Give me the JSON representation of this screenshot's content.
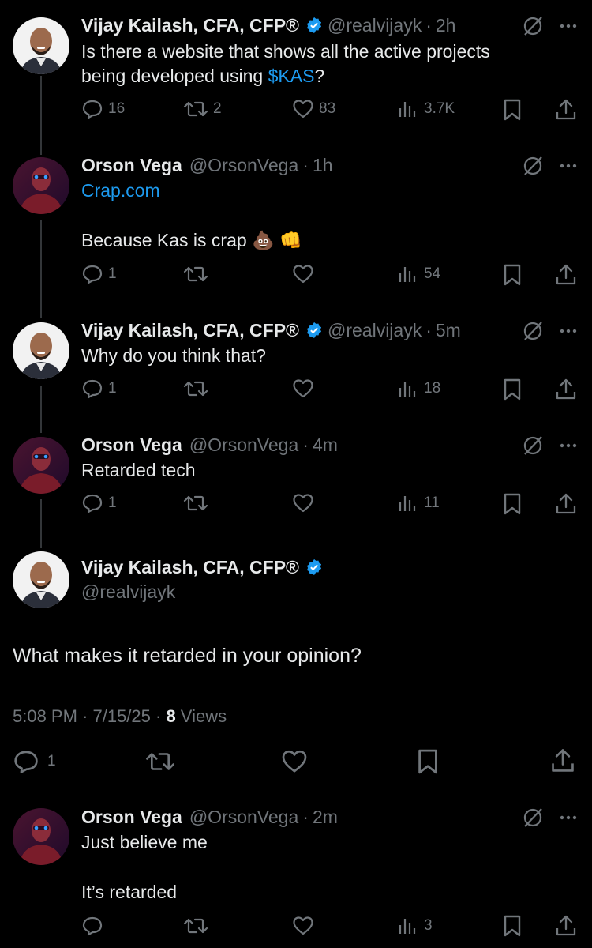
{
  "thread": [
    {
      "author": "Vijay Kailash, CFA, CFP®",
      "handle": "@realvijayk",
      "dot": "·",
      "time": "2h",
      "text_line1": "Is there a website that shows all the active projects",
      "text_line2_pre": "being developed using ",
      "text_line2_link": "$KAS",
      "text_line2_post": "?",
      "replies": "16",
      "reposts": "2",
      "likes": "83",
      "views": "3.7K"
    },
    {
      "author": "Orson Vega",
      "handle": "@OrsonVega",
      "dot": "·",
      "time": "1h",
      "link": "Crap.com",
      "text": "Because Kas is crap 💩 👊",
      "replies": "1",
      "views": "54"
    },
    {
      "author": "Vijay Kailash, CFA, CFP®",
      "handle": "@realvijayk",
      "dot": "·",
      "time": "5m",
      "text": "Why do you think that?",
      "replies": "1",
      "views": "18"
    },
    {
      "author": "Orson Vega",
      "handle": "@OrsonVega",
      "dot": "·",
      "time": "4m",
      "text": "Retarded tech",
      "replies": "1",
      "views": "11"
    }
  ],
  "focused": {
    "author": "Vijay Kailash, CFA, CFP®",
    "handle": "@realvijayk",
    "text": "What makes it retarded in your opinion?",
    "timestamp": "5:08 PM · 7/15/25 · ",
    "views_count": "8",
    "views_label": " Views",
    "replies": "1"
  },
  "reply": {
    "author": "Orson Vega",
    "handle": "@OrsonVega",
    "dot": "·",
    "time": "2m",
    "text_line1": "Just believe me",
    "text_line2": "It’s retarded",
    "views": "3"
  },
  "colors": {
    "background": "#000000",
    "text": "#e7e9ea",
    "muted": "#71767b",
    "link": "#1d9bf0",
    "verified": "#1d9bf0"
  },
  "icons": [
    "reply-icon",
    "repost-icon",
    "like-icon",
    "views-icon",
    "bookmark-icon",
    "share-icon",
    "grok-icon",
    "more-icon",
    "verified-icon"
  ]
}
